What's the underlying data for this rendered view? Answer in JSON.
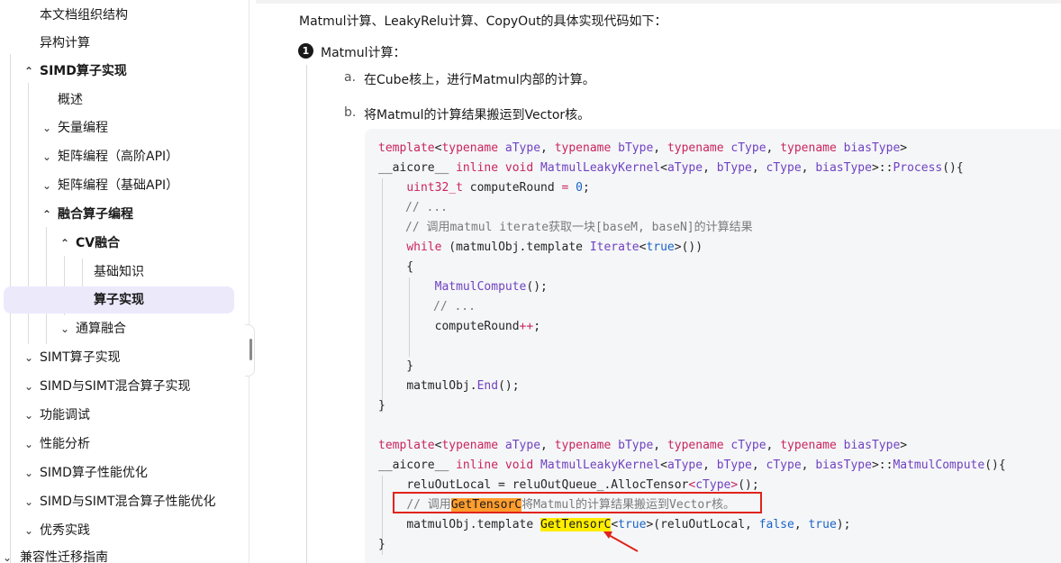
{
  "sidebar": {
    "items": [
      {
        "label": "本文档组织结构",
        "chevron": "none"
      },
      {
        "label": "异构计算",
        "chevron": "none"
      },
      {
        "label": "SIMD算子实现",
        "chevron": "up"
      },
      {
        "label": "概述",
        "chevron": "none"
      },
      {
        "label": "矢量编程",
        "chevron": "down"
      },
      {
        "label": "矩阵编程（高阶API）",
        "chevron": "down"
      },
      {
        "label": "矩阵编程（基础API）",
        "chevron": "down"
      },
      {
        "label": "融合算子编程",
        "chevron": "up"
      },
      {
        "label": "CV融合",
        "chevron": "up"
      },
      {
        "label": "基础知识",
        "chevron": "none"
      },
      {
        "label": "算子实现",
        "chevron": "none"
      },
      {
        "label": "通算融合",
        "chevron": "down"
      },
      {
        "label": "SIMT算子实现",
        "chevron": "down"
      },
      {
        "label": "SIMD与SIMT混合算子实现",
        "chevron": "down"
      },
      {
        "label": "功能调试",
        "chevron": "down"
      },
      {
        "label": "性能分析",
        "chevron": "down"
      },
      {
        "label": "SIMD算子性能优化",
        "chevron": "down"
      },
      {
        "label": "SIMD与SIMT混合算子性能优化",
        "chevron": "down"
      },
      {
        "label": "优秀实践",
        "chevron": "down"
      },
      {
        "label": "兼容性迁移指南",
        "chevron": "down"
      }
    ],
    "active_item": "算子实现"
  },
  "content": {
    "intro": "Matmul计算、LeakyRelu计算、CopyOut的具体实现代码如下：",
    "step_number": "1",
    "step_title": "Matmul计算：",
    "substeps": [
      {
        "marker": "a.",
        "text": "在Cube核上，进行Matmul内部的计算。"
      },
      {
        "marker": "b.",
        "text": "将Matmul的计算结果搬运到Vector核。"
      }
    ],
    "code": {
      "l1_kw": "template",
      "l1_a": "<",
      "l1_tn": "typename",
      "l1_v1": "aType",
      "l1_v2": "bType",
      "l1_v3": "cType",
      "l1_v4": "biasType",
      "aicore": "__aicore__",
      "inline": "inline",
      "void": "void",
      "kernel": "MatmulLeakyKernel",
      "process": "Process",
      "uint32": "uint32_t",
      "compute_round": "computeRound",
      "zero": "0",
      "ellipsis_comment": "// ...",
      "iterate_comment": "// 调用matmul iterate获取一块[baseM, baseN]的计算结果",
      "while": "while",
      "matmul_obj_template": "(matmulObj.template ",
      "iterate": "Iterate",
      "true": "true",
      "matmul_compute": "MatmulCompute",
      "compute_round_inc": "computeRound",
      "end_call": "matmulObj.",
      "end": "End",
      "relu_out_local": "reluOutLocal = reluOutQueue_.AllocTensor",
      "ctype_generic": "cType",
      "comment_pre": "// 调用",
      "get_tensor_c": "GetTensorC",
      "comment_post": "将Matmul的计算结果搬运到Vector核。",
      "matmul_obj_template2": "matmulObj.template ",
      "args_pre": "(reluOutLocal, ",
      "false": "false",
      "args_post": ");"
    }
  },
  "colors": {
    "active_nav_bg": "#ece9fb",
    "keyword": "#c9255d",
    "type": "#6f42c1",
    "number": "#1a64c8",
    "highlight_orange": "#ff9d2e",
    "highlight_yellow": "#ffee00",
    "annotation_red": "#e0241b"
  }
}
